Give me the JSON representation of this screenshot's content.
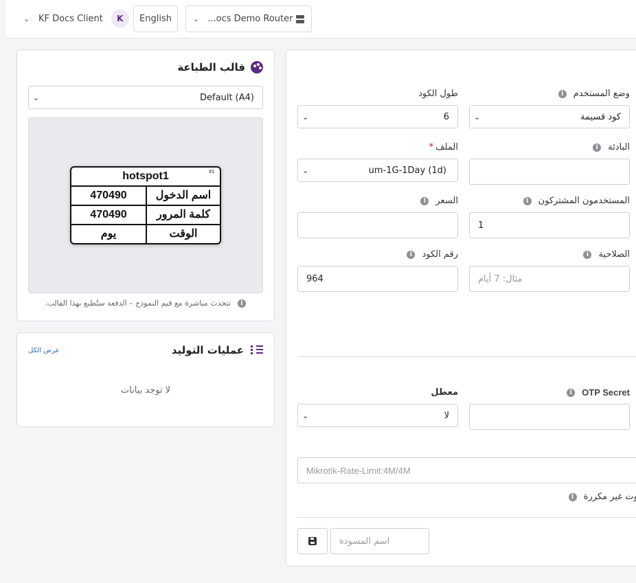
{
  "topbar": {
    "client_name": "KF Docs Client",
    "avatar_letter": "K",
    "language": "English",
    "router_name": "...ocs Demo Router"
  },
  "print_template": {
    "title": "قالب الطباعة",
    "selected": "Default (A4)",
    "ticket": {
      "number": "#1",
      "header": "hotspot1",
      "rows": [
        {
          "label": "اسم الدخول",
          "value": "470490"
        },
        {
          "label": "كلمة المرور",
          "value": "470490"
        },
        {
          "label": "الوقت",
          "value": "يوم"
        }
      ]
    },
    "note": "تتحدث مباشرة مع قيم النموذج – الدفعة ستُطبع بهذا القالب."
  },
  "generation": {
    "title": "عمليات التوليد",
    "view_all": "عرض الكل",
    "empty": "لا توجد بيانات"
  },
  "form": {
    "user_mode": {
      "label": "وضع المستخدم",
      "value": "كود قسيمة"
    },
    "code_length": {
      "label": "طول الكود",
      "value": "6"
    },
    "prefix": {
      "label": "البادئة",
      "value": ""
    },
    "profile": {
      "label": "الملف",
      "required_mark": "*",
      "value": "um-1G-1Day (1d)"
    },
    "shared_users": {
      "label": "المستخدمون المشتركون",
      "value": "1"
    },
    "price": {
      "label": "السعر",
      "value": ""
    },
    "validity": {
      "label": "الصلاحية",
      "placeholder": "مثال: 7 أيام"
    },
    "code_number": {
      "label": "رقم الكود",
      "value": "964"
    },
    "otp_secret": {
      "label": "OTP Secret",
      "value": ""
    },
    "disabled": {
      "label": "معطل",
      "value": "لا"
    },
    "rate_limit": {
      "placeholder": "Mikrotik-Rate-Limit:4M/4M"
    },
    "unique_routes": {
      "label": "روت غير مكررة"
    },
    "draft_name": {
      "placeholder": "اسم المسودة"
    }
  }
}
